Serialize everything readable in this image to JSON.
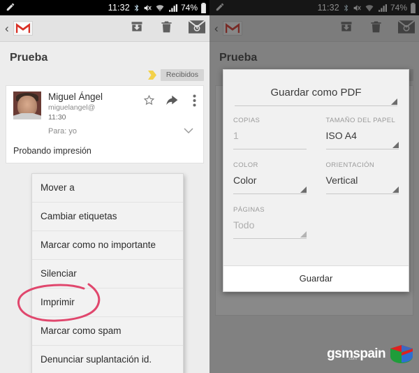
{
  "statusbar": {
    "time": "11:32",
    "battery_pct": "74%",
    "icons": [
      "pencil-icon",
      "bluetooth-icon",
      "mute-icon",
      "wifi-icon",
      "signal-icon",
      "battery-icon"
    ]
  },
  "actionbar": {
    "back_label": "‹",
    "app_icon": "gmail-icon",
    "actions": [
      "archive-icon",
      "delete-icon",
      "mark-unread-icon"
    ]
  },
  "conversation": {
    "subject": "Prueba",
    "label_chip": "Recibidos",
    "message": {
      "sender": "Miguel Ángel",
      "email": "miguelangel@",
      "time": "11:30",
      "to": "Para: yo",
      "body": "Probando impresión",
      "icons": [
        "star-icon",
        "reply-icon",
        "overflow-menu-icon",
        "expand-chevron-icon"
      ]
    }
  },
  "popup_menu": {
    "items": [
      "Mover a",
      "Cambiar etiquetas",
      "Marcar como no importante",
      "Silenciar",
      "Imprimir",
      "Marcar como spam",
      "Denunciar suplantación id."
    ],
    "highlighted_item": "Imprimir",
    "annotation_color": "#e0476d"
  },
  "print_dialog": {
    "title": "Guardar como PDF",
    "fields": {
      "copies": {
        "label": "COPIAS",
        "value": "1"
      },
      "paper_size": {
        "label": "TAMAÑO DEL PAPEL",
        "value": "ISO A4"
      },
      "color": {
        "label": "COLOR",
        "value": "Color"
      },
      "orientation": {
        "label": "ORIENTACIÓN",
        "value": "Vertical"
      },
      "pages": {
        "label": "PÁGINAS",
        "value": "Todo"
      }
    },
    "save_button": "Guardar"
  },
  "watermark": {
    "text": "gsmspain",
    "suffix": ".com",
    "icon": "gsmspain-logo-icon"
  },
  "colors": {
    "accent_red": "#d93025",
    "dialog_bg": "#f1f1f1",
    "screen_bg": "#ededed",
    "annotation": "#e0476d"
  }
}
